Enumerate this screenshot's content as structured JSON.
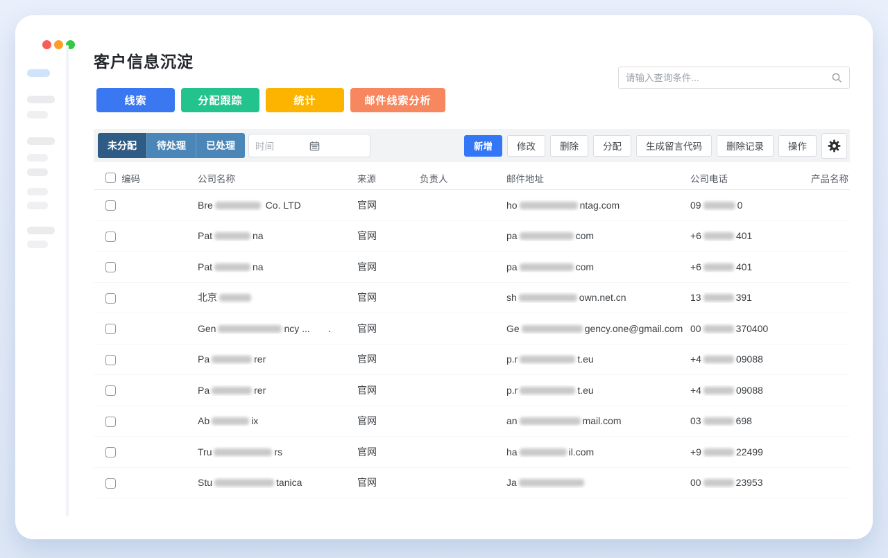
{
  "window": {
    "traffic_lights": [
      "#f85e57",
      "#fb9e2a",
      "#35c845"
    ]
  },
  "header": {
    "title": "客户信息沉淀"
  },
  "search": {
    "placeholder": "请输入查询条件..."
  },
  "nav_buttons": [
    {
      "label": "线索",
      "color": "#3a78f2"
    },
    {
      "label": "分配跟踪",
      "color": "#22c38d"
    },
    {
      "label": "统计",
      "color": "#fcb400"
    },
    {
      "label": "邮件线索分析",
      "color": "#f6875f"
    }
  ],
  "filter_bar": {
    "tabs": [
      {
        "label": "未分配",
        "active": true
      },
      {
        "label": "待处理",
        "active": false
      },
      {
        "label": "已处理",
        "active": false
      }
    ],
    "date_placeholder": "时间",
    "actions": [
      {
        "label": "新增",
        "primary": true
      },
      {
        "label": "修改"
      },
      {
        "label": "删除"
      },
      {
        "label": "分配"
      },
      {
        "label": "生成留言代码"
      },
      {
        "label": "删除记录"
      },
      {
        "label": "操作"
      }
    ]
  },
  "table": {
    "columns": [
      "编码",
      "公司名称",
      "来源",
      "负责人",
      "邮件地址",
      "公司电话",
      "产品名称"
    ],
    "rows": [
      {
        "company": [
          {
            "t": "Bre"
          },
          {
            "b": 66
          },
          {
            "t": " Co. LTD"
          }
        ],
        "source": "官网",
        "email": [
          {
            "t": "ho"
          },
          {
            "b": 84
          },
          {
            "t": "ntag.com"
          }
        ],
        "phone": [
          {
            "t": "09"
          },
          {
            "b": 46
          },
          {
            "t": "0"
          }
        ]
      },
      {
        "company": [
          {
            "t": "Pat"
          },
          {
            "b": 52
          },
          {
            "t": "na"
          }
        ],
        "source": "官网",
        "email": [
          {
            "t": "pa"
          },
          {
            "b": 78
          },
          {
            "t": "com"
          }
        ],
        "phone": [
          {
            "t": "+6"
          },
          {
            "b": 44
          },
          {
            "t": "401"
          }
        ]
      },
      {
        "company": [
          {
            "t": "Pat"
          },
          {
            "b": 52
          },
          {
            "t": "na"
          }
        ],
        "source": "官网",
        "email": [
          {
            "t": "pa"
          },
          {
            "b": 78
          },
          {
            "t": "com"
          }
        ],
        "phone": [
          {
            "t": "+6"
          },
          {
            "b": 44
          },
          {
            "t": "401"
          }
        ]
      },
      {
        "company": [
          {
            "t": "北京"
          },
          {
            "b": 46
          }
        ],
        "source": "官网",
        "email": [
          {
            "t": "sh"
          },
          {
            "b": 84
          },
          {
            "t": "own.net.cn"
          }
        ],
        "phone": [
          {
            "t": "13"
          },
          {
            "b": 44
          },
          {
            "t": "391"
          }
        ]
      },
      {
        "company": [
          {
            "t": "Gen"
          },
          {
            "b": 92
          },
          {
            "t": "ncy ..."
          },
          {
            "t": ".",
            "ml": 26
          }
        ],
        "source": "官网",
        "email": [
          {
            "t": "Ge"
          },
          {
            "b": 88
          },
          {
            "t": "gency.one@gmail.com"
          }
        ],
        "phone": [
          {
            "t": "00"
          },
          {
            "b": 44
          },
          {
            "t": "370400"
          }
        ]
      },
      {
        "company": [
          {
            "t": "Pa"
          },
          {
            "b": 58
          },
          {
            "t": "rer"
          }
        ],
        "source": "官网",
        "email": [
          {
            "t": "p.r"
          },
          {
            "b": 80
          },
          {
            "t": "t.eu"
          }
        ],
        "phone": [
          {
            "t": "+4"
          },
          {
            "b": 44
          },
          {
            "t": "09088"
          }
        ]
      },
      {
        "company": [
          {
            "t": "Pa"
          },
          {
            "b": 58
          },
          {
            "t": "rer"
          }
        ],
        "source": "官网",
        "email": [
          {
            "t": "p.r"
          },
          {
            "b": 80
          },
          {
            "t": "t.eu"
          }
        ],
        "phone": [
          {
            "t": "+4"
          },
          {
            "b": 44
          },
          {
            "t": "09088"
          }
        ]
      },
      {
        "company": [
          {
            "t": "Ab"
          },
          {
            "b": 54
          },
          {
            "t": "ix"
          }
        ],
        "source": "官网",
        "email": [
          {
            "t": "an"
          },
          {
            "b": 88
          },
          {
            "t": "mail.com"
          }
        ],
        "phone": [
          {
            "t": "03"
          },
          {
            "b": 44
          },
          {
            "t": "698"
          }
        ]
      },
      {
        "company": [
          {
            "t": "Tru"
          },
          {
            "b": 84
          },
          {
            "t": "rs"
          }
        ],
        "source": "官网",
        "email": [
          {
            "t": "ha"
          },
          {
            "b": 68
          },
          {
            "t": "il.com"
          }
        ],
        "phone": [
          {
            "t": "+9"
          },
          {
            "b": 44
          },
          {
            "t": "22499"
          }
        ]
      },
      {
        "company": [
          {
            "t": "Stu"
          },
          {
            "b": 86
          },
          {
            "t": "tanica"
          }
        ],
        "source": "官网",
        "email": [
          {
            "t": "Ja"
          },
          {
            "b": 94
          }
        ],
        "phone": [
          {
            "t": "00"
          },
          {
            "b": 44
          },
          {
            "t": "23953"
          }
        ]
      }
    ]
  },
  "colors": {
    "accent_blue": "#3377f6",
    "tab_active": "#2e5c84",
    "tab_inactive": "#4a86b8",
    "toolbar_bg": "#f2f3f5"
  }
}
